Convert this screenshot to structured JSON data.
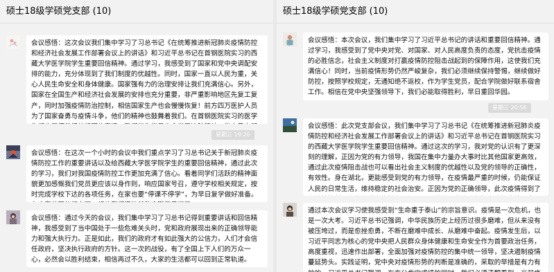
{
  "left": {
    "title": "硕士18级学硕党支部 (10)",
    "messages": [
      {
        "text": "会议感悟：这次会议我们集中学习了习总书记《在统筹推进新冠肺炎疫情防控和经济社会发展工作部署会议上的讲话》和习近平总书记在首钢医院实习的西藏大学医学院学生重要回信精神。通过学习，我感受到了国家和党中央调配安排的能力，充分体现到了我们制度的优越性。同时，国家一直以人民为重，关心人民生命安全和身体健康。国家强有力的治理安排让我们充满信心。另外，国家在全国生产和经济社会发展的安排也充分重要，非严重影响地区先复工复产，同时加强疫情防治控制，相信国家生产也会慢慢恢复！前方四万医护人员为了国家奋勇与疫情斗争，他们的精神也鼓舞着我们。在首钢医院实习的医学生们也是怀着报效祖国的家情，我们学生党员也会学习这种精神，做自己力所能及的事情来报效祖国。相信这次疫情会很快过去！"
      },
      {
        "text": "会议感悟：在这次一个小时的会议中我们重点学习了习总书记关于新冠肺炎疫情防控工作的重要讲话以及给西藏大学医学院学生的重要回信精神，通过此次的学习，我们对我国疫情防控工作更加充满了信心。看着同学们活跃的精神面貌更加感慨我们党员更应该以身作则，响应国家号召，遵守学校相关规定，按时完成学校下达的各项任务，在家也要“停课不停学”，为早日复学做好准备。在大家共同的努力下，相信我们很快就能齐聚三号楼了～"
      },
      {
        "text": "会议感悟：通过今天的会议，我们集中学习了习总书记得到重要讲话和回信精神，我感受到了当中国处于一些危难关头时，党和政府展现出来的正确领导能力和强大执行力。正是如此，我们的政府才有如此强大的公信力，人们才会信任政府，坚决执行政府的方针。这一次的战役，有了全国上下人们的万众一心，必然会以胜利结束，相信再过不久，大家的生活都可以回到正常轨道。"
      }
    ],
    "timestamp": "星期三 19:20"
  },
  "right": {
    "title": "硕士18级学硕党支部 (10)",
    "messages": [
      {
        "text": "会议感悟：本次会议，我们集中学习了习近平总书记的讲话和重要回信精神。通过学习，我感受到了党中央对党、对国家、对人民高度负责的态度，党抗击疫情的必胜信念，社会主义制度对打赢疫情防控阻击战起到的保障作用，这使我们充满信心！同时，当前疫情形势仍然严峻复杂，我们必须继续保持警惕，继续做好防控，按照学校规定，无通知绝不返校，作为学生党员，配合学院做好联系宿舍工作。相信在党中央坚强领导下，我们必能取得胜利，早日重回华园。"
      },
      {
        "text": "会议感悟：此次党支部会议，我们集中学习了习总书记《在统筹推进新冠肺炎疫情防控和经济社会发展工作部署会议上的讲话》和习近平总书记在首钢医院实习的西藏大学医学院学生重要回信精神。通过这次的学习，我对党的认识有了更深刻的理解，正因为党的有力领导，我国在集中力量办大事时比其他国家更高效，通过此次疫情阻击战也可以看出社会主义制度的优越性以及党的领导的正确性，有效性。身在湖北，更能感受到党的有力领导，在疫情最严重的时候，仍能保证人民的日常生活，维持稳定的社会治安。正因为党的正确领导，此次疫情得到了有效地控制，相信在党中央的坚强领导下，我们一定会取得打赢这场疫情阻击战，早日回归正常的生活。"
      },
      {
        "text": "通过本次会议学习使我感受到“生命重于泰山”的宗旨意识。疫情是一次危机，也是一次大考。习近平总书记强调，中华民族历史上经历过很多磨难，但从来没有被压垮过，而是愈挫愈勇，不断在磨难中成长、从磨难中奋起。疫情发生后，以习近平同志为核心的党中央把人民群众身体健康和生命安全作为首要政治任务，高度重视，迅速作出部署，全面加强对疫情防控的集中统一领导，坚决遏制疫情蔓延势头。实践证明，党中央对疫情形势的判断是准确的，采取的举措是有力有效的。习近平总书记强调，在充分肯定成绩的同时，我们必须清醒看到，当前疫情形势依然严峻复杂，防"
      }
    ],
    "timestamp": "星期三 20:56"
  }
}
